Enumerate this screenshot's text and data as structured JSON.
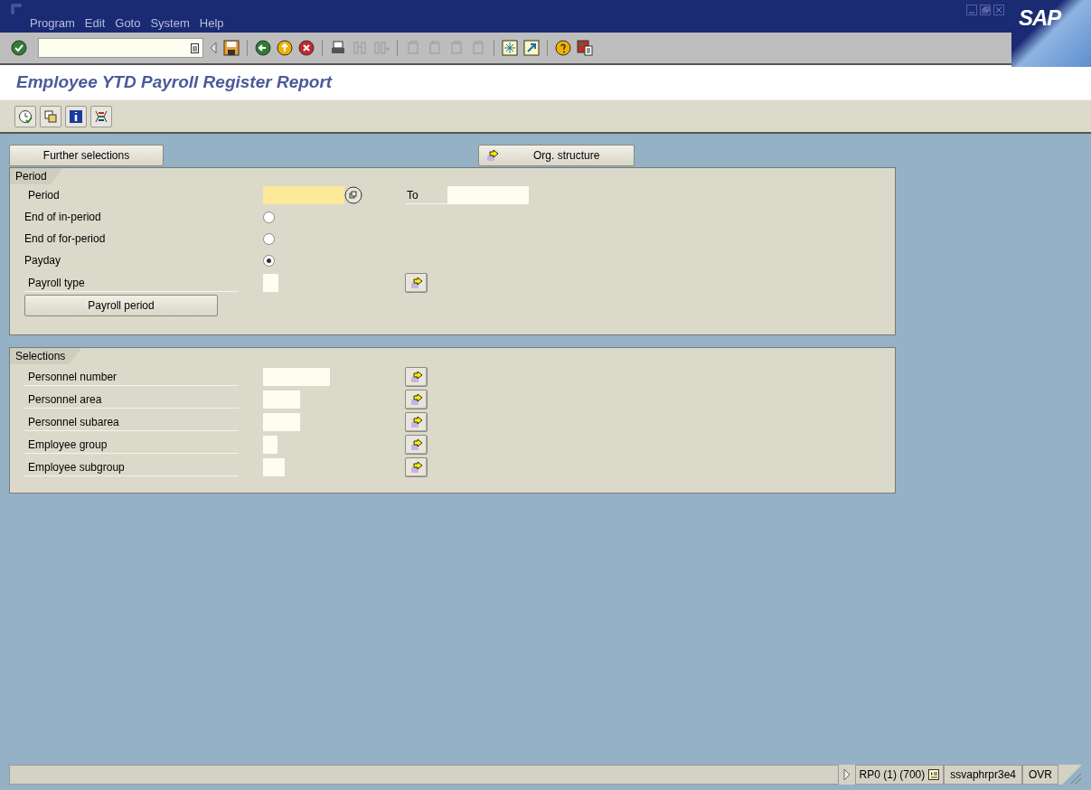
{
  "menu": [
    {
      "label": "Program"
    },
    {
      "label": "Edit"
    },
    {
      "label": "Goto"
    },
    {
      "label": "System"
    },
    {
      "label": "Help"
    }
  ],
  "logo": "SAP",
  "title": "Employee YTD Payroll Register Report",
  "buttons": {
    "further_selections": "Further selections",
    "org_structure": "Org. structure"
  },
  "period": {
    "title": "Period",
    "period_label": "Period",
    "to_label": "To",
    "options": [
      {
        "label": "End of in-period",
        "selected": false
      },
      {
        "label": "End of for-period",
        "selected": false
      },
      {
        "label": "Payday",
        "selected": true
      }
    ],
    "payroll_type_label": "Payroll type",
    "payroll_period_button": "Payroll period"
  },
  "selections": {
    "title": "Selections",
    "rows": [
      {
        "label": "Personnel number"
      },
      {
        "label": "Personnel area"
      },
      {
        "label": "Personnel subarea"
      },
      {
        "label": "Employee group"
      },
      {
        "label": "Employee subgroup"
      }
    ]
  },
  "status_bar": {
    "system": "RP0 (1) (700)",
    "server": "ssvaphrpr3e4",
    "mode": "OVR"
  }
}
